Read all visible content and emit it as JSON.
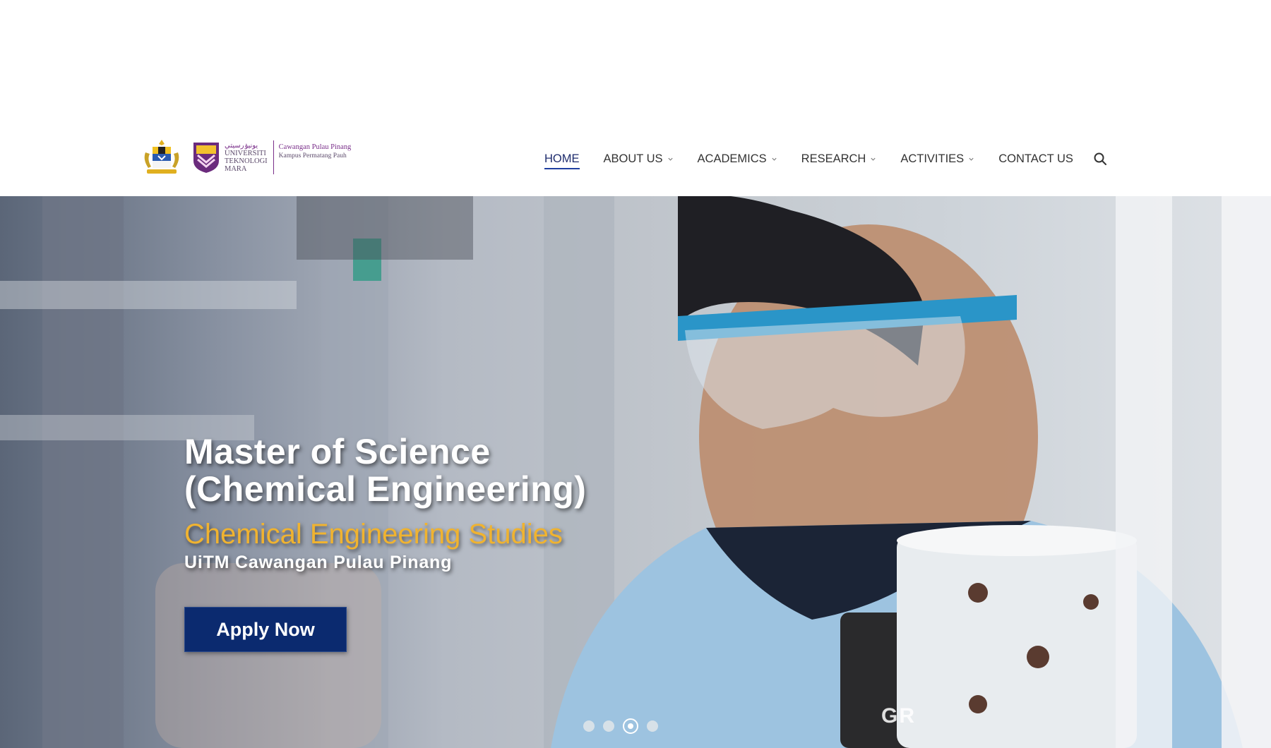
{
  "header": {
    "logo": {
      "jawi_text": "يونيۏرسيتي",
      "university_lines": [
        "UNIVERSITI",
        "TEKNOLOGI",
        "MARA"
      ],
      "campus_name": "Cawangan Pulau Pinang",
      "campus_sub": "Kampus Permatang Pauh"
    },
    "nav": [
      {
        "label": "HOME",
        "active": true,
        "has_dropdown": false
      },
      {
        "label": "ABOUT US",
        "active": false,
        "has_dropdown": true
      },
      {
        "label": "ACADEMICS",
        "active": false,
        "has_dropdown": true
      },
      {
        "label": "RESEARCH",
        "active": false,
        "has_dropdown": true
      },
      {
        "label": "ACTIVITIES",
        "active": false,
        "has_dropdown": true
      },
      {
        "label": "CONTACT US",
        "active": false,
        "has_dropdown": false
      }
    ],
    "search_icon": "search-icon"
  },
  "hero": {
    "title_line1": "Master of Science",
    "title_line2": "(Chemical Engineering)",
    "subtitle": "Chemical Engineering Studies",
    "campus_line": "UiTM Cawangan Pulau Pinang",
    "cta_label": "Apply Now",
    "background_text": "GR",
    "slide_count": 4,
    "active_slide": 3
  },
  "colors": {
    "nav_text": "#333333",
    "active_underline": "#1f3fa0",
    "subtitle": "#f0b330",
    "cta_background": "#0b2a6f",
    "uitm_purple": "#7a2f8a"
  }
}
